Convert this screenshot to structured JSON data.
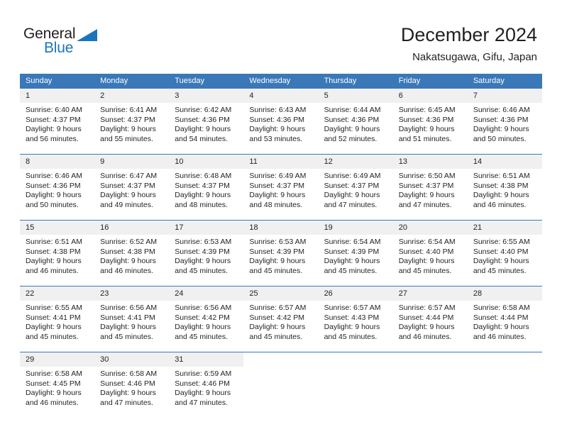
{
  "brand": {
    "name_part1": "General",
    "name_part2": "Blue"
  },
  "header": {
    "month_title": "December 2024",
    "location": "Nakatsugawa, Gifu, Japan"
  },
  "theme": {
    "header_blue": "#3a78b8",
    "brand_blue": "#1b75bb",
    "day_number_bg": "#f0f0f0",
    "text": "#231f20"
  },
  "weekdays": [
    "Sunday",
    "Monday",
    "Tuesday",
    "Wednesday",
    "Thursday",
    "Friday",
    "Saturday"
  ],
  "weeks": [
    [
      {
        "day": "1",
        "sunrise": "Sunrise: 6:40 AM",
        "sunset": "Sunset: 4:37 PM",
        "daylight_line1": "Daylight: 9 hours",
        "daylight_line2": "and 56 minutes."
      },
      {
        "day": "2",
        "sunrise": "Sunrise: 6:41 AM",
        "sunset": "Sunset: 4:37 PM",
        "daylight_line1": "Daylight: 9 hours",
        "daylight_line2": "and 55 minutes."
      },
      {
        "day": "3",
        "sunrise": "Sunrise: 6:42 AM",
        "sunset": "Sunset: 4:36 PM",
        "daylight_line1": "Daylight: 9 hours",
        "daylight_line2": "and 54 minutes."
      },
      {
        "day": "4",
        "sunrise": "Sunrise: 6:43 AM",
        "sunset": "Sunset: 4:36 PM",
        "daylight_line1": "Daylight: 9 hours",
        "daylight_line2": "and 53 minutes."
      },
      {
        "day": "5",
        "sunrise": "Sunrise: 6:44 AM",
        "sunset": "Sunset: 4:36 PM",
        "daylight_line1": "Daylight: 9 hours",
        "daylight_line2": "and 52 minutes."
      },
      {
        "day": "6",
        "sunrise": "Sunrise: 6:45 AM",
        "sunset": "Sunset: 4:36 PM",
        "daylight_line1": "Daylight: 9 hours",
        "daylight_line2": "and 51 minutes."
      },
      {
        "day": "7",
        "sunrise": "Sunrise: 6:46 AM",
        "sunset": "Sunset: 4:36 PM",
        "daylight_line1": "Daylight: 9 hours",
        "daylight_line2": "and 50 minutes."
      }
    ],
    [
      {
        "day": "8",
        "sunrise": "Sunrise: 6:46 AM",
        "sunset": "Sunset: 4:36 PM",
        "daylight_line1": "Daylight: 9 hours",
        "daylight_line2": "and 50 minutes."
      },
      {
        "day": "9",
        "sunrise": "Sunrise: 6:47 AM",
        "sunset": "Sunset: 4:37 PM",
        "daylight_line1": "Daylight: 9 hours",
        "daylight_line2": "and 49 minutes."
      },
      {
        "day": "10",
        "sunrise": "Sunrise: 6:48 AM",
        "sunset": "Sunset: 4:37 PM",
        "daylight_line1": "Daylight: 9 hours",
        "daylight_line2": "and 48 minutes."
      },
      {
        "day": "11",
        "sunrise": "Sunrise: 6:49 AM",
        "sunset": "Sunset: 4:37 PM",
        "daylight_line1": "Daylight: 9 hours",
        "daylight_line2": "and 48 minutes."
      },
      {
        "day": "12",
        "sunrise": "Sunrise: 6:49 AM",
        "sunset": "Sunset: 4:37 PM",
        "daylight_line1": "Daylight: 9 hours",
        "daylight_line2": "and 47 minutes."
      },
      {
        "day": "13",
        "sunrise": "Sunrise: 6:50 AM",
        "sunset": "Sunset: 4:37 PM",
        "daylight_line1": "Daylight: 9 hours",
        "daylight_line2": "and 47 minutes."
      },
      {
        "day": "14",
        "sunrise": "Sunrise: 6:51 AM",
        "sunset": "Sunset: 4:38 PM",
        "daylight_line1": "Daylight: 9 hours",
        "daylight_line2": "and 46 minutes."
      }
    ],
    [
      {
        "day": "15",
        "sunrise": "Sunrise: 6:51 AM",
        "sunset": "Sunset: 4:38 PM",
        "daylight_line1": "Daylight: 9 hours",
        "daylight_line2": "and 46 minutes."
      },
      {
        "day": "16",
        "sunrise": "Sunrise: 6:52 AM",
        "sunset": "Sunset: 4:38 PM",
        "daylight_line1": "Daylight: 9 hours",
        "daylight_line2": "and 46 minutes."
      },
      {
        "day": "17",
        "sunrise": "Sunrise: 6:53 AM",
        "sunset": "Sunset: 4:39 PM",
        "daylight_line1": "Daylight: 9 hours",
        "daylight_line2": "and 45 minutes."
      },
      {
        "day": "18",
        "sunrise": "Sunrise: 6:53 AM",
        "sunset": "Sunset: 4:39 PM",
        "daylight_line1": "Daylight: 9 hours",
        "daylight_line2": "and 45 minutes."
      },
      {
        "day": "19",
        "sunrise": "Sunrise: 6:54 AM",
        "sunset": "Sunset: 4:39 PM",
        "daylight_line1": "Daylight: 9 hours",
        "daylight_line2": "and 45 minutes."
      },
      {
        "day": "20",
        "sunrise": "Sunrise: 6:54 AM",
        "sunset": "Sunset: 4:40 PM",
        "daylight_line1": "Daylight: 9 hours",
        "daylight_line2": "and 45 minutes."
      },
      {
        "day": "21",
        "sunrise": "Sunrise: 6:55 AM",
        "sunset": "Sunset: 4:40 PM",
        "daylight_line1": "Daylight: 9 hours",
        "daylight_line2": "and 45 minutes."
      }
    ],
    [
      {
        "day": "22",
        "sunrise": "Sunrise: 6:55 AM",
        "sunset": "Sunset: 4:41 PM",
        "daylight_line1": "Daylight: 9 hours",
        "daylight_line2": "and 45 minutes."
      },
      {
        "day": "23",
        "sunrise": "Sunrise: 6:56 AM",
        "sunset": "Sunset: 4:41 PM",
        "daylight_line1": "Daylight: 9 hours",
        "daylight_line2": "and 45 minutes."
      },
      {
        "day": "24",
        "sunrise": "Sunrise: 6:56 AM",
        "sunset": "Sunset: 4:42 PM",
        "daylight_line1": "Daylight: 9 hours",
        "daylight_line2": "and 45 minutes."
      },
      {
        "day": "25",
        "sunrise": "Sunrise: 6:57 AM",
        "sunset": "Sunset: 4:42 PM",
        "daylight_line1": "Daylight: 9 hours",
        "daylight_line2": "and 45 minutes."
      },
      {
        "day": "26",
        "sunrise": "Sunrise: 6:57 AM",
        "sunset": "Sunset: 4:43 PM",
        "daylight_line1": "Daylight: 9 hours",
        "daylight_line2": "and 45 minutes."
      },
      {
        "day": "27",
        "sunrise": "Sunrise: 6:57 AM",
        "sunset": "Sunset: 4:44 PM",
        "daylight_line1": "Daylight: 9 hours",
        "daylight_line2": "and 46 minutes."
      },
      {
        "day": "28",
        "sunrise": "Sunrise: 6:58 AM",
        "sunset": "Sunset: 4:44 PM",
        "daylight_line1": "Daylight: 9 hours",
        "daylight_line2": "and 46 minutes."
      }
    ],
    [
      {
        "day": "29",
        "sunrise": "Sunrise: 6:58 AM",
        "sunset": "Sunset: 4:45 PM",
        "daylight_line1": "Daylight: 9 hours",
        "daylight_line2": "and 46 minutes."
      },
      {
        "day": "30",
        "sunrise": "Sunrise: 6:58 AM",
        "sunset": "Sunset: 4:46 PM",
        "daylight_line1": "Daylight: 9 hours",
        "daylight_line2": "and 47 minutes."
      },
      {
        "day": "31",
        "sunrise": "Sunrise: 6:59 AM",
        "sunset": "Sunset: 4:46 PM",
        "daylight_line1": "Daylight: 9 hours",
        "daylight_line2": "and 47 minutes."
      },
      {
        "day": "",
        "sunrise": "",
        "sunset": "",
        "daylight_line1": "",
        "daylight_line2": ""
      },
      {
        "day": "",
        "sunrise": "",
        "sunset": "",
        "daylight_line1": "",
        "daylight_line2": ""
      },
      {
        "day": "",
        "sunrise": "",
        "sunset": "",
        "daylight_line1": "",
        "daylight_line2": ""
      },
      {
        "day": "",
        "sunrise": "",
        "sunset": "",
        "daylight_line1": "",
        "daylight_line2": ""
      }
    ]
  ]
}
